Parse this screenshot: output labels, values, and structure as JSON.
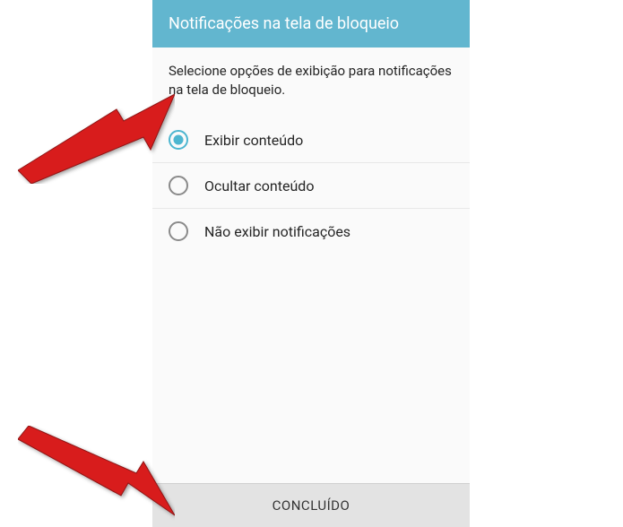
{
  "header": {
    "title": "Notificações na tela de bloqueio"
  },
  "description": "Selecione opções de exibição para notificações na tela de bloqueio.",
  "options": [
    {
      "label": "Exibir conteúdo",
      "selected": true
    },
    {
      "label": "Ocultar conteúdo",
      "selected": false
    },
    {
      "label": "Não exibir notificações",
      "selected": false
    }
  ],
  "footer": {
    "done_label": "CONCLUÍDO"
  }
}
